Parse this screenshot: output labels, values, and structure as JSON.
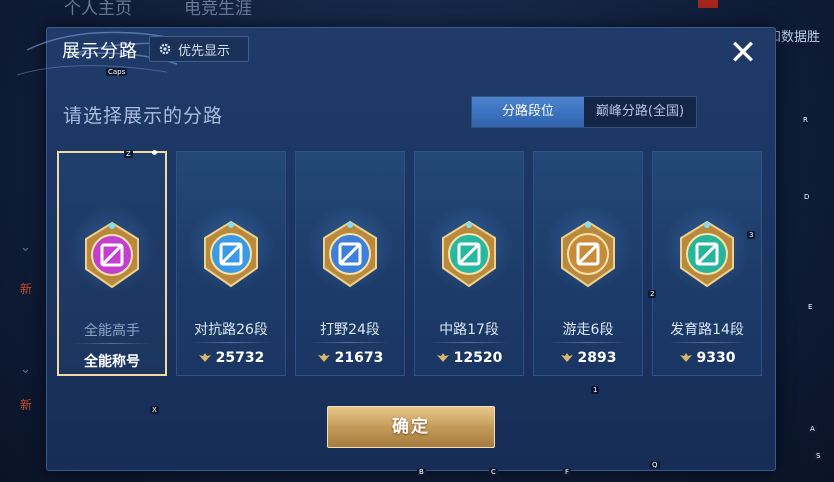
{
  "background": {
    "tabs": [
      "个人主页",
      "电竞生涯"
    ],
    "topright_text": "战和数据胜",
    "side_new_label": "新"
  },
  "dialog": {
    "title": "展示分路",
    "priority_button": "优先显示",
    "subtitle": "请选择展示的分路",
    "tabs": [
      {
        "label": "分路段位",
        "active": true
      },
      {
        "label": "巅峰分路(全国)",
        "active": false
      }
    ],
    "cards": [
      {
        "label": "全能高手",
        "value": "全能称号",
        "selected": true,
        "icon": "all-round-badge-icon",
        "color": "#c23fd0",
        "show_score_icon": false
      },
      {
        "label": "对抗路26段",
        "value": "25732",
        "selected": false,
        "icon": "clash-lane-badge-icon",
        "color": "#3a9ae6",
        "show_score_icon": true
      },
      {
        "label": "打野24段",
        "value": "21673",
        "selected": false,
        "icon": "jungle-badge-icon",
        "color": "#3d7fdb",
        "show_score_icon": true
      },
      {
        "label": "中路17段",
        "value": "12520",
        "selected": false,
        "icon": "mid-lane-badge-icon",
        "color": "#27b8a0",
        "show_score_icon": true
      },
      {
        "label": "游走6段",
        "value": "2893",
        "selected": false,
        "icon": "roam-badge-icon",
        "color": "#c98b3a",
        "show_score_icon": true
      },
      {
        "label": "发育路14段",
        "value": "9330",
        "selected": false,
        "icon": "farm-lane-badge-icon",
        "color": "#26b59a",
        "show_score_icon": true
      }
    ],
    "confirm_button": "确定"
  },
  "overlay_hints": [
    "Caps",
    "Z",
    "X",
    "B",
    "C",
    "F",
    "Q",
    "1",
    "2",
    "3",
    "R",
    "D",
    "E",
    "A",
    "S"
  ]
}
